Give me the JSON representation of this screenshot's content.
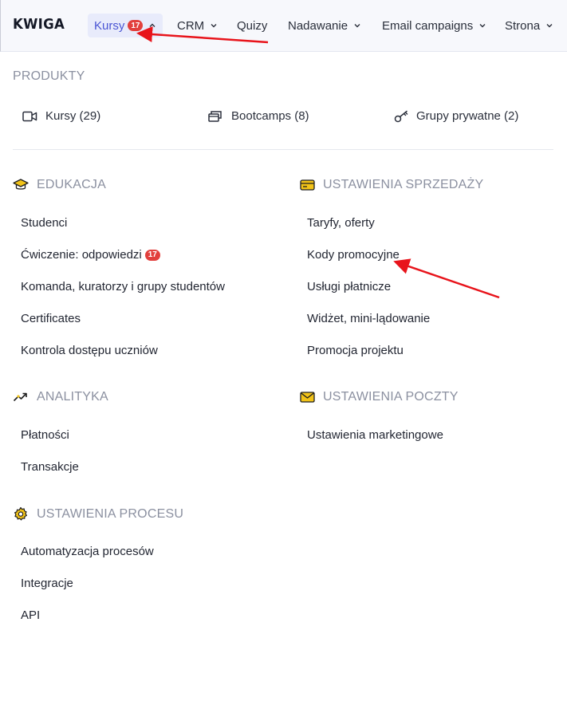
{
  "header": {
    "logo": "KWIGA",
    "nav": [
      {
        "label": "Kursy",
        "badge": "17"
      },
      {
        "label": "CRM"
      },
      {
        "label": "Quizy"
      },
      {
        "label": "Nadawanie"
      },
      {
        "label": "Email campaigns"
      },
      {
        "label": "Strona"
      }
    ]
  },
  "products": {
    "title": "PRODUKTY",
    "items": [
      {
        "label": "Kursy (29)",
        "icon": "video-camera-icon"
      },
      {
        "label": "Bootcamps (8)",
        "icon": "cards-stack-icon"
      },
      {
        "label": "Grupy prywatne (2)",
        "icon": "key-icon"
      }
    ]
  },
  "sections": {
    "edukacja": {
      "title": "EDUKACJA",
      "icon": "graduation-cap-icon",
      "items": [
        "Studenci",
        "Ćwiczenie: odpowiedzi",
        "Komanda, kuratorzy i grupy studentów",
        "Certificates",
        "Kontrola dostępu uczniów"
      ],
      "badge": "17"
    },
    "sprzedaz": {
      "title": "USTAWIENIA SPRZEDAŻY",
      "icon": "credit-card-icon",
      "items": [
        "Taryfy, oferty",
        "Kody promocyjne",
        "Usługi płatnicze",
        "Widżet, mini-lądowanie",
        "Promocja projektu"
      ]
    },
    "analityka": {
      "title": "ANALITYKA",
      "icon": "trend-up-icon",
      "items": [
        "Płatności",
        "Transakcje"
      ]
    },
    "poczta": {
      "title": "USTAWIENIA POCZTY",
      "icon": "envelope-icon",
      "items": [
        "Ustawienia marketingowe"
      ]
    },
    "proces": {
      "title": "USTAWIENIA PROCESU",
      "icon": "gear-icon",
      "items": [
        "Automatyzacja procesów",
        "Integracje",
        "API"
      ]
    }
  },
  "colors": {
    "accent": "#4a55d4",
    "badge": "#e2403d",
    "icon_yellow": "#f2c318",
    "annotation_arrow": "#e8141b"
  }
}
